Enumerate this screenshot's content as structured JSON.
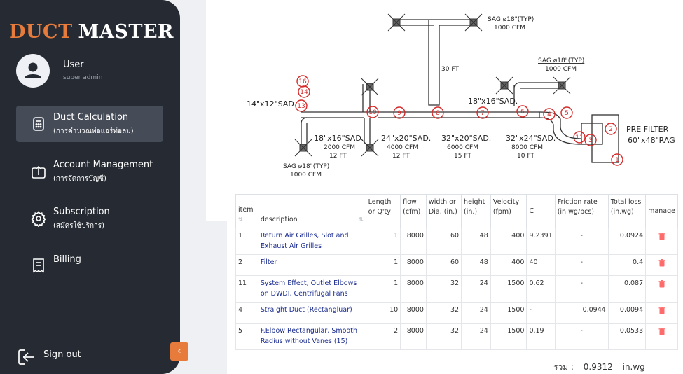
{
  "app": {
    "logo_part1": "DUCT",
    "logo_part2": "MASTER"
  },
  "user": {
    "name": "User",
    "role": "super admin"
  },
  "nav": [
    {
      "title": "Duct Calculation",
      "subtitle": "(การคำนวณท่อแอร์ท่อลม)",
      "icon": "calculator-icon",
      "active": true
    },
    {
      "title": "Account Management",
      "subtitle": "(การจัดการบัญชี)",
      "icon": "account-upload-icon",
      "active": false
    },
    {
      "title": "Subscription",
      "subtitle": "(สมัครใช้บริการ)",
      "icon": "gear-icon",
      "active": false
    },
    {
      "title": "Billing",
      "subtitle": "",
      "icon": "receipt-icon",
      "active": false
    }
  ],
  "signout": {
    "label": "Sign out"
  },
  "diagram": {
    "labels": {
      "sag_top": "SAG ø18\"(TYP)",
      "cfm_top": "1000 CFM",
      "sag_right": "SAG ø18\"(TYP)",
      "cfm_right": "1000 CFM",
      "sag_bottom": "SAG ø18\"(TYP)",
      "cfm_bottom": "1000 CFM",
      "ft30": "30 FT",
      "sad_14x12": "14\"x12\"SAD.",
      "sad_18x16_top": "18\"x16\"SAD.",
      "sad_18x16_left": "18\"x16\"SAD.",
      "cfm_2000": "2000 CFM",
      "ft12a": "12 FT",
      "sad_24x20": "24\"x20\"SAD.",
      "cfm_4000": "4000 CFM",
      "ft12b": "12 FT",
      "sad_32x20": "32\"x20\"SAD.",
      "cfm_6000": "6000 CFM",
      "ft15": "15 FT",
      "sad_32x24": "32\"x24\"SAD.",
      "cfm_8000": "8000 CFM",
      "ft10": "10 FT",
      "pre_filter": "PRE FILTER",
      "rag": "60\"x48\"RAG"
    },
    "markers": [
      "16",
      "14",
      "13",
      "10",
      "9",
      "8",
      "7",
      "6",
      "4",
      "5",
      "11",
      "3",
      "2",
      "1"
    ]
  },
  "table": {
    "headers": [
      "item",
      "description",
      "Length or Q'ty",
      "flow (cfm)",
      "width or Dia. (in.)",
      "height (in.)",
      "Velocity (fpm)",
      "C",
      "Friction rate (in.wg/pcs)",
      "Total loss (in.wg)",
      "manage"
    ],
    "rows": [
      {
        "item": "1",
        "description": "Return Air Grilles, Slot and Exhaust Air Grilles",
        "length": "1",
        "flow": "8000",
        "width": "60",
        "height": "48",
        "velocity": "400",
        "c": "9.2391",
        "friction": "-",
        "total": "0.0924"
      },
      {
        "item": "2",
        "description": "Filter",
        "length": "1",
        "flow": "8000",
        "width": "60",
        "height": "48",
        "velocity": "400",
        "c": "40",
        "friction": "-",
        "total": "0.4"
      },
      {
        "item": "11",
        "description": "System Effect, Outlet Elbows on DWDI, Centrifugal Fans",
        "length": "1",
        "flow": "8000",
        "width": "32",
        "height": "24",
        "velocity": "1500",
        "c": "0.62",
        "friction": "-",
        "total": "0.087"
      },
      {
        "item": "4",
        "description": "Straight Duct (Rectangluar)",
        "length": "10",
        "flow": "8000",
        "width": "32",
        "height": "24",
        "velocity": "1500",
        "c": "-",
        "friction": "0.0944",
        "total": "0.0094"
      },
      {
        "item": "5",
        "description": "F.Elbow Rectangular, Smooth Radius without Vanes (15)",
        "length": "2",
        "flow": "8000",
        "width": "32",
        "height": "24",
        "velocity": "1500",
        "c": "0.19",
        "friction": "-",
        "total": "0.0533"
      }
    ]
  },
  "summary": {
    "label": "รวม :",
    "value": "0.9312",
    "unit": "in.wg"
  },
  "colors": {
    "sidebar": "#262b33",
    "accent": "#e67b3c",
    "marker": "#d62b2b",
    "link": "#1b2d8f"
  }
}
